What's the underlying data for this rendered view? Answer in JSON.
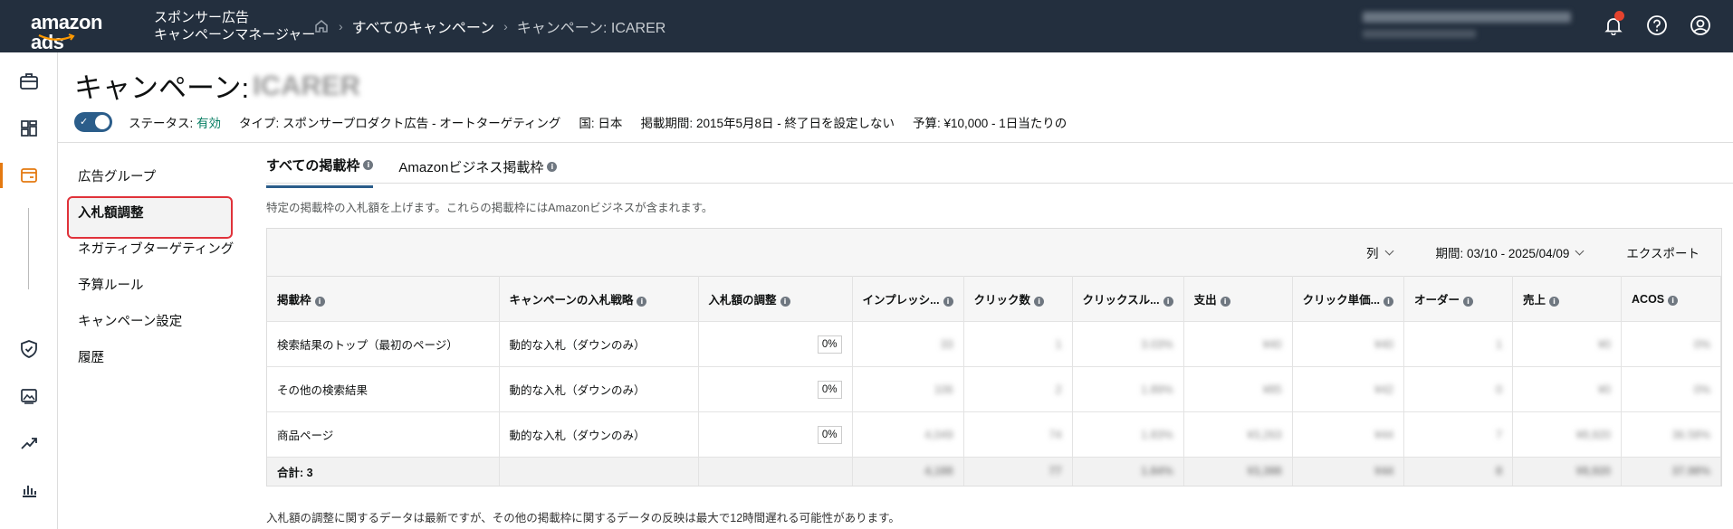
{
  "topbar": {
    "logo": "amazon ads",
    "product_line1": "スポンサー広告",
    "product_line2": "キャンペーンマネージャー",
    "breadcrumbs": [
      "すべてのキャンペーン",
      "キャンペーン: ICARER"
    ]
  },
  "page": {
    "title_prefix": "キャンペーン:",
    "title_name": "ICARER",
    "status_label": "ステータス:",
    "status_value": "有効",
    "type": "タイプ: スポンサープロダクト広告 - オートターゲティング",
    "country": "国: 日本",
    "period": "掲載期間: 2015年5月8日 - 終了日を設定しない",
    "budget": "予算: ¥10,000 - 1日当たりの"
  },
  "sidenav": [
    "広告グループ",
    "入札額調整",
    "ネガティブターゲティング",
    "予算ルール",
    "キャンペーン設定",
    "履歴"
  ],
  "tabs": [
    "すべての掲載枠",
    "Amazonビジネス掲載枠"
  ],
  "description": "特定の掲載枠の入札額を上げます。これらの掲載枠にはAmazonビジネスが含まれます。",
  "toolbar": {
    "columns": "列",
    "period": "期間: 03/10 - 2025/04/09",
    "export": "エクスポート"
  },
  "table": {
    "headers": [
      "掲載枠",
      "キャンペーンの入札戦略",
      "入札額の調整",
      "インプレッシ...",
      "クリック数",
      "クリックスル...",
      "支出",
      "クリック単価...",
      "オーダー",
      "売上",
      "ACOS"
    ],
    "rows": [
      {
        "placement": "検索結果のトップ（最初のページ）",
        "strategy": "動的な入札（ダウンのみ）",
        "adjust": "0%",
        "vals": [
          "33",
          "1",
          "3.03%",
          "¥40",
          "¥40",
          "1",
          "¥0",
          "0%"
        ]
      },
      {
        "placement": "その他の検索結果",
        "strategy": "動的な入札（ダウンのみ）",
        "adjust": "0%",
        "vals": [
          "106",
          "2",
          "1.89%",
          "¥85",
          "¥42",
          "0",
          "¥0",
          "0%"
        ]
      },
      {
        "placement": "商品ページ",
        "strategy": "動的な入札（ダウンのみ）",
        "adjust": "0%",
        "vals": [
          "4,049",
          "74",
          "1.83%",
          "¥3,263",
          "¥44",
          "7",
          "¥8,920",
          "36.58%"
        ]
      }
    ],
    "total_label": "合計: 3",
    "total_vals": [
      "4,188",
      "77",
      "1.84%",
      "¥3,388",
      "¥44",
      "8",
      "¥8,920",
      "37.98%"
    ]
  },
  "footer_note": "入札額の調整に関するデータは最新ですが、その他の掲載枠に関するデータの反映は最大で12時間遅れる可能性があります。"
}
